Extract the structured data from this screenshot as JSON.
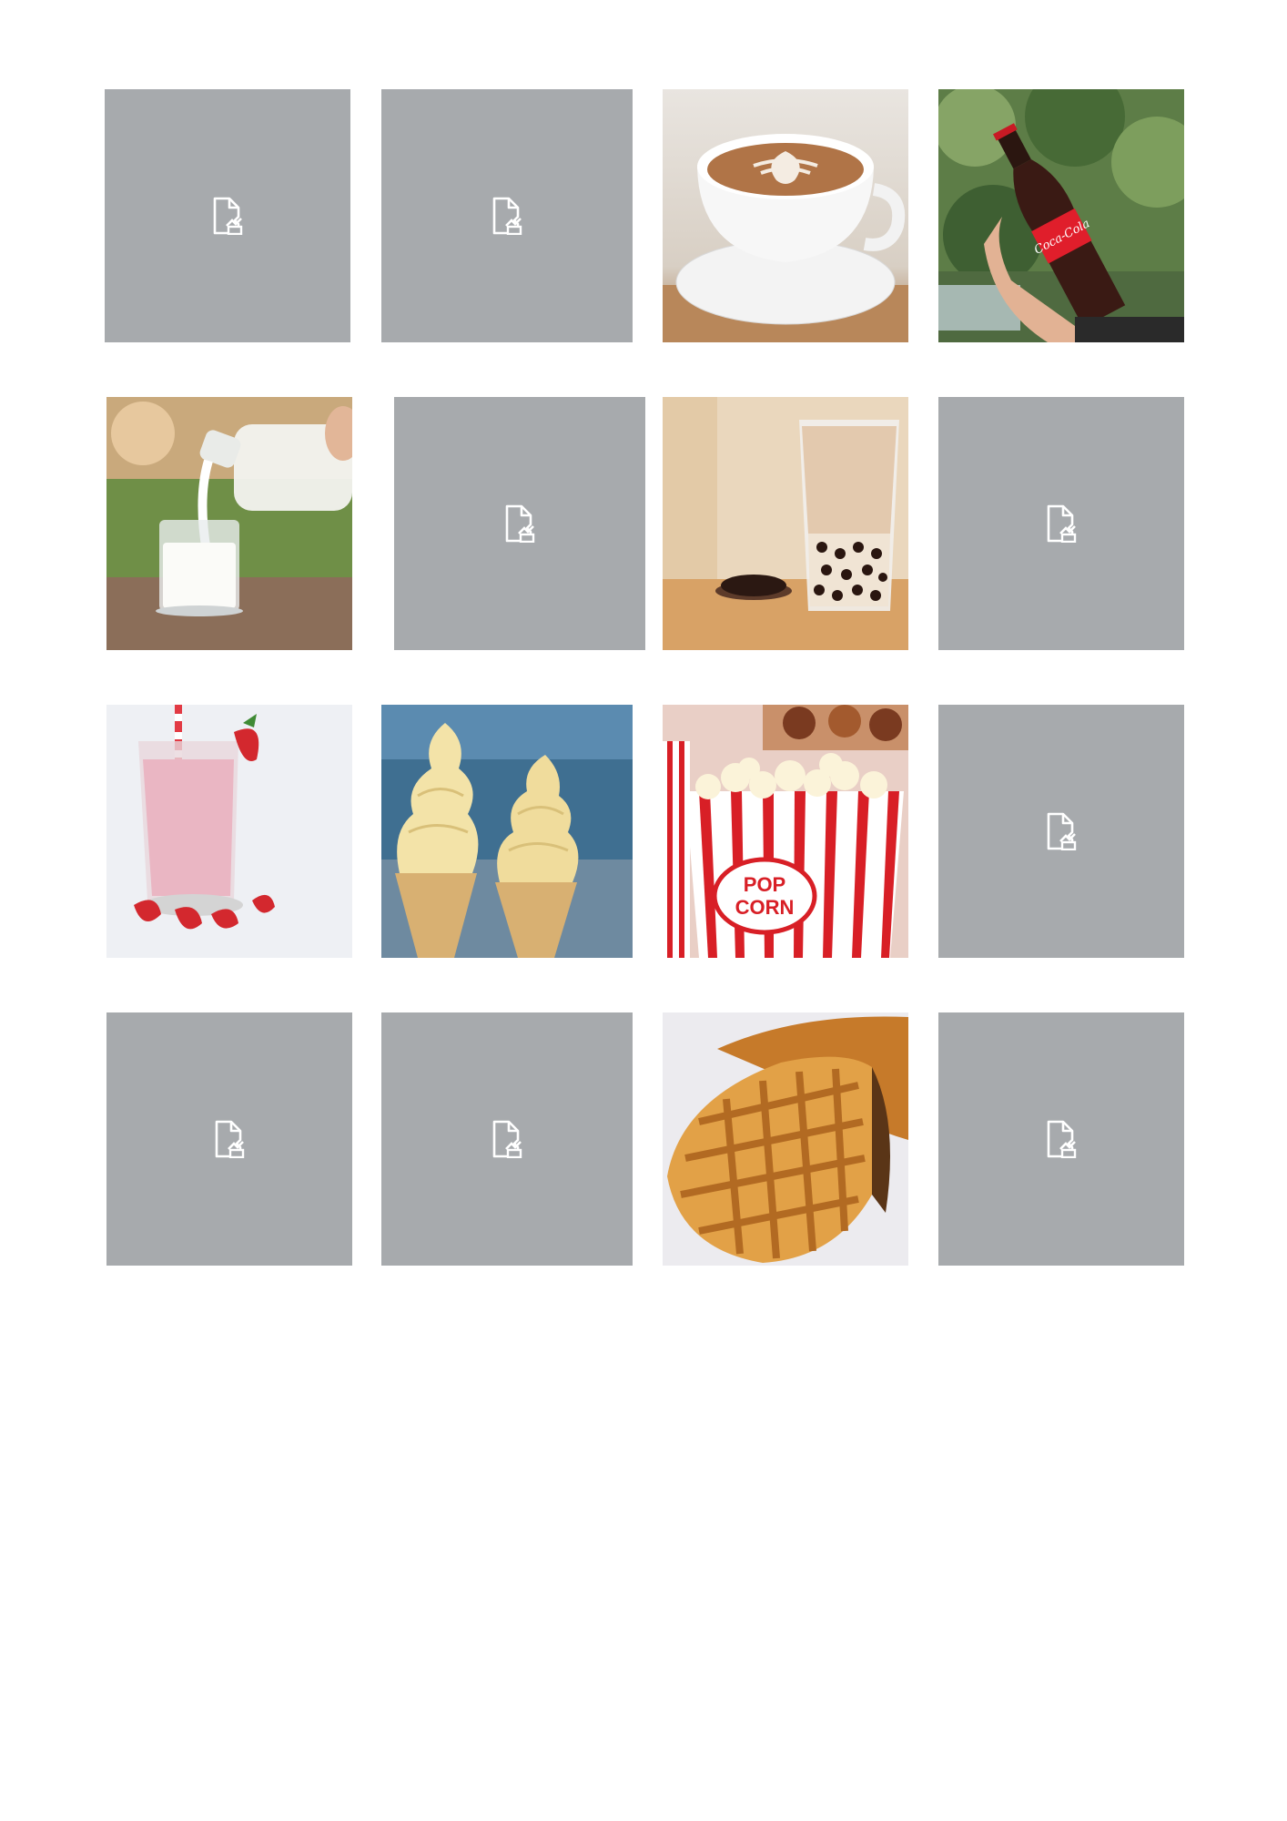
{
  "grid": {
    "background": "#ffffff",
    "placeholder_color": "#a7aaad",
    "tiles": [
      {
        "kind": "broken-image",
        "icon": "broken-image-icon"
      },
      {
        "kind": "broken-image",
        "icon": "broken-image-icon"
      },
      {
        "kind": "photo",
        "subject": "latte-art-coffee"
      },
      {
        "kind": "photo",
        "subject": "coca-cola-bottle",
        "logo_text": "Coca-Cola"
      },
      {
        "kind": "photo",
        "subject": "milk-pour"
      },
      {
        "kind": "broken-image",
        "icon": "broken-image-icon"
      },
      {
        "kind": "photo",
        "subject": "bubble-milk-tea"
      },
      {
        "kind": "broken-image",
        "icon": "broken-image-icon"
      },
      {
        "kind": "photo",
        "subject": "strawberry-milkshake"
      },
      {
        "kind": "photo",
        "subject": "ice-cream-cones"
      },
      {
        "kind": "photo",
        "subject": "popcorn",
        "logo_text": "POP CORN"
      },
      {
        "kind": "broken-image",
        "icon": "broken-image-icon"
      },
      {
        "kind": "broken-image",
        "icon": "broken-image-icon"
      },
      {
        "kind": "broken-image",
        "icon": "broken-image-icon"
      },
      {
        "kind": "photo",
        "subject": "waffle"
      },
      {
        "kind": "broken-image",
        "icon": "broken-image-icon"
      }
    ]
  }
}
